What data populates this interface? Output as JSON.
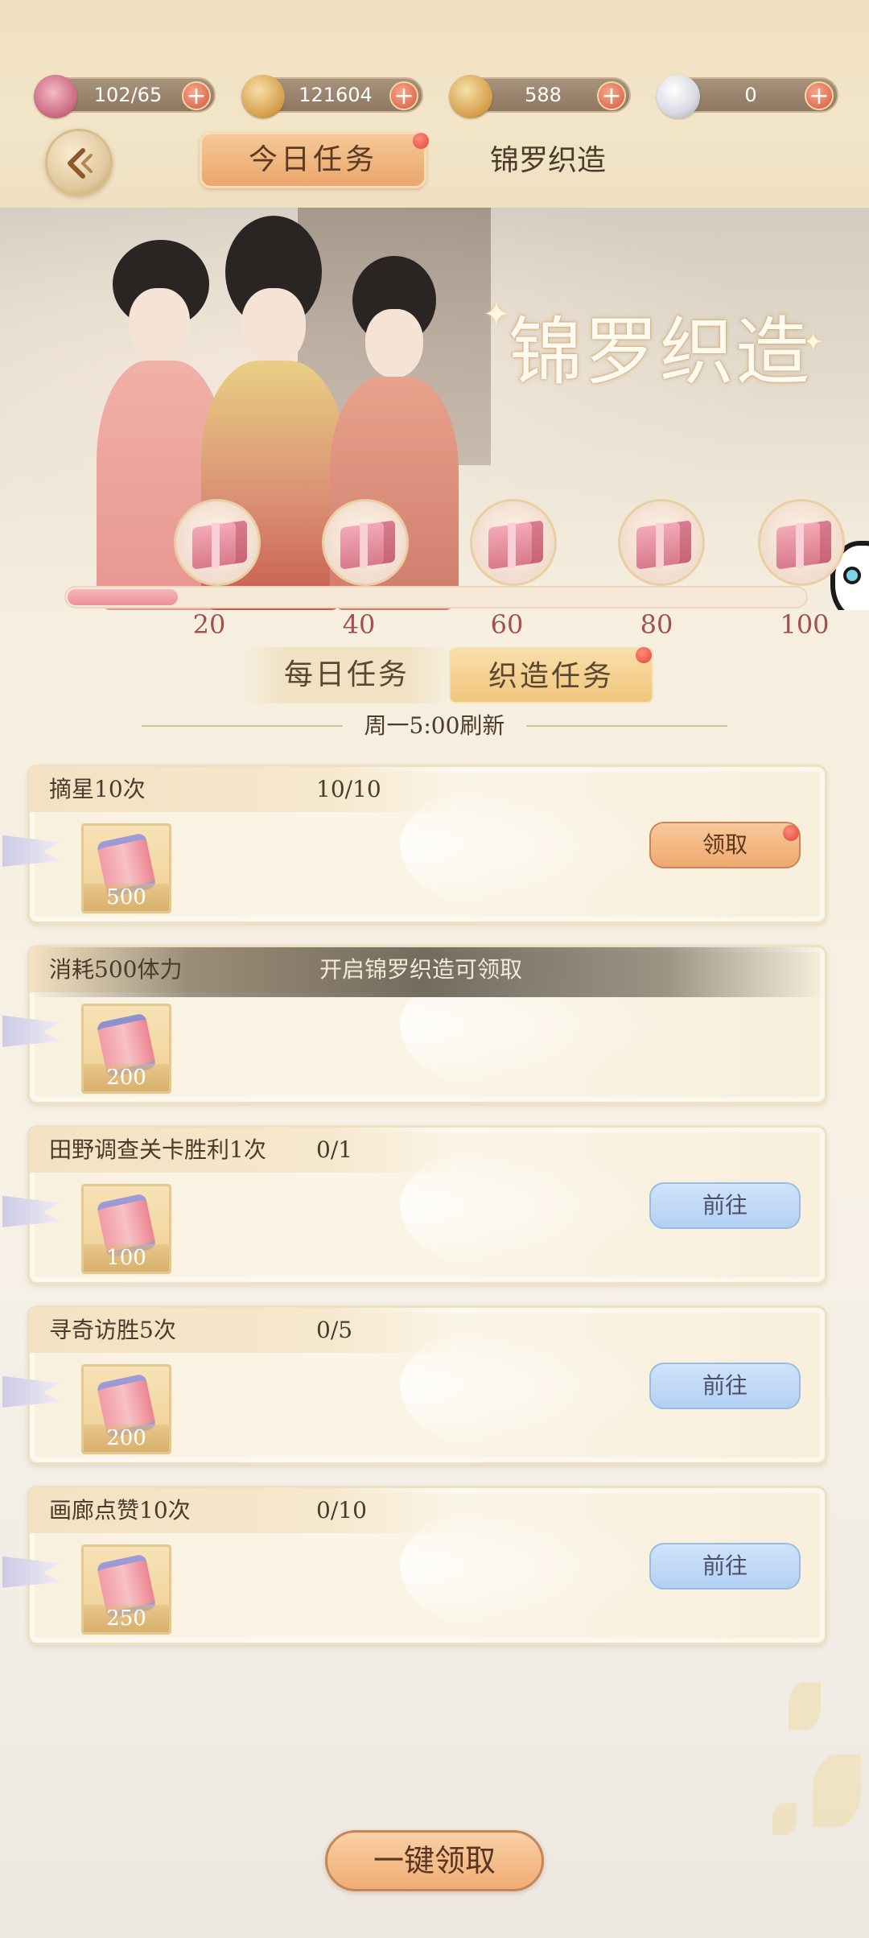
{
  "resources": [
    {
      "icon": "flower-icon",
      "value": "102/65"
    },
    {
      "icon": "gold-coin-icon",
      "value": "121604"
    },
    {
      "icon": "jade-coin-icon",
      "value": "588"
    },
    {
      "icon": "pearl-icon",
      "value": "0"
    }
  ],
  "header": {
    "tab_today": "今日任务",
    "tab_weave": "锦罗织造"
  },
  "banner": {
    "title": "锦罗织造"
  },
  "progress": {
    "fraction": 0.15,
    "milestones": [
      "20",
      "40",
      "60",
      "80",
      "100"
    ]
  },
  "subtabs": {
    "daily": "每日任务",
    "weave": "织造任务"
  },
  "refresh_text": "周一5:00刷新",
  "tasks": [
    {
      "title": "摘星10次",
      "progress": "10/10",
      "reward_qty": "500",
      "action": "领取",
      "state": "claim"
    },
    {
      "title": "消耗500体力",
      "progress": "",
      "reward_qty": "200",
      "action": "",
      "state": "locked",
      "locked_text": "开启锦罗织造可领取"
    },
    {
      "title": "田野调查关卡胜利1次",
      "progress": "0/1",
      "reward_qty": "100",
      "action": "前往",
      "state": "go"
    },
    {
      "title": "寻奇访胜5次",
      "progress": "0/5",
      "reward_qty": "200",
      "action": "前往",
      "state": "go"
    },
    {
      "title": "画廊点赞10次",
      "progress": "0/10",
      "reward_qty": "250",
      "action": "前往",
      "state": "go"
    }
  ],
  "claim_all": "一键领取",
  "colors": {
    "accent_orange": "#efa96f",
    "go_blue": "#b3d0f3",
    "progress_pink": "#ee8f99"
  }
}
